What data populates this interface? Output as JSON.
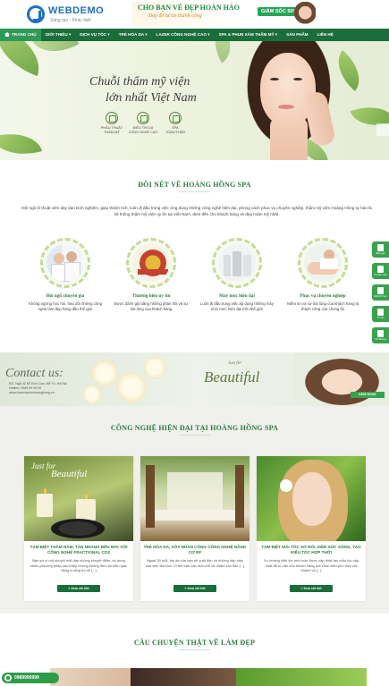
{
  "header": {
    "logo_text": "WEBDEMO",
    "logo_slogan": "Sáng tạo - Khác biệt",
    "ad_title": "CHO BẠN VẺ ĐẸP HOÀN HẢO",
    "ad_subtitle": "Đẹp để tự tin thành công",
    "ad_badge": "GIẢM SỐC 50%+"
  },
  "nav": {
    "items": [
      {
        "label": "TRANG CHỦ"
      },
      {
        "label": "GIỚI THIỆU ▾"
      },
      {
        "label": "DỊCH VỤ TÓC ▾"
      },
      {
        "label": "TRẺ HÓA DA ▾"
      },
      {
        "label": "LAZER CÔNG NGHỆ CAO ▾"
      },
      {
        "label": "SPA & PHUN XĂM THẨM MỸ ▾"
      },
      {
        "label": "SẢN PHẨM"
      },
      {
        "label": "LIÊN HỆ"
      }
    ]
  },
  "hero": {
    "title_line1": "Chuỗi thẩm mỹ viện",
    "title_line2": "lớn nhất Việt Nam",
    "features": [
      {
        "l1": "PHẪU THUẬT",
        "l2": "THẨM MỸ"
      },
      {
        "l1": "ĐIỀU TRỊ DA",
        "l2": "CÔNG NGHỆ CAO"
      },
      {
        "l1": "SPA",
        "l2": "TOÀN THÂN"
      }
    ]
  },
  "about": {
    "title": "ĐÔI NÉT VỀ HOÀNG HỒNG SPA",
    "text": "Đội ngũ kĩ thuật viên dày dạn kinh nghiệm, giàu thành tích, luôn đi đầu trong việc ứng dụng những công nghệ hiện đại, phong cách phục vụ chuyên nghiệp, thẩm mỹ viện Hoàng Hồng tự hào là hệ thống thẩm mỹ viện uy tín tại Việt Nam, đem đến cho khách hàng vẻ đẹp hoàn mỹ nhất.",
    "columns": [
      {
        "name": "Đội ngũ chuyên gia",
        "desc": "Không ngừng học hỏi, trau dồi những công nghệ làm đẹp hàng đầu thế giới"
      },
      {
        "name": "Thương hiệu uy tín",
        "desc": "Được đánh giá bằng những phản hồi và sự hài lòng của khách hàng"
      },
      {
        "name": "Máy móc hiện đại",
        "desc": "Luôn đi đầu trong việc áp dụng những máy móc mới, hiện đại trên thế giới"
      },
      {
        "name": "Phục vụ chuyên nghiệp",
        "desc": "Niềm tin và sự hài lòng của khách hàng là thành công của chúng tôi"
      }
    ]
  },
  "side_widgets": [
    {
      "label": "Bảng giá"
    },
    {
      "label": "Khuyến mãi"
    },
    {
      "label": "Đặt lịch hẹn"
    },
    {
      "label": "Tư vấn"
    },
    {
      "label": "Chỉ đường"
    }
  ],
  "contact": {
    "title": "Contact us:",
    "addr1": "ĐC: Ngõ 42 Đỗ Đức Dục, Mễ Trì, Hà Nội",
    "addr2": "Hotline: 0989.99.99.99",
    "addr3": "www.thammyvienhoanghong.vn",
    "just_for": "Just for",
    "beautiful": "Beautiful",
    "cta": "XEM NGAY"
  },
  "tech": {
    "title": "CÔNG NGHỆ HIỆN ĐẠI TẠI HOÀNG HỒNG SPA",
    "cards": [
      {
        "title": "TẠM BIỆT THÂM NÁM, TÀN NHANG ĐẾN 99% VỚI CÔNG NGHỆ FRACTIONAL CO2",
        "desc": "Bạn sợ vì nốt khuyết mãi dày những khuyết điểm, số dụng nhiều phương pháp can thiệp nhưng không đem lại hiệu quả, đang lo lắng thì sẽ [...]",
        "btn": "» Xem chi tiết"
      },
      {
        "title": "TRẺ HÓA DA, XÓA NHĂN CÔNG CÔNG NGHỆ NÂNG CƠ RF",
        "desc": "Ngoài 30 tuổi, làn da của bạn sẽ xuất đầu có những dấu hiệu của việc lão hoá. Vì thế bạn cần một chế độ chăm sóc đặc [...]",
        "btn": "» Xem chi tiết"
      },
      {
        "title": "TẠM BIỆT MÁI TÓC XƠ RỐI, KÉM SỨC SỐNG, TẠO KIỂU TÓC HỢP THỜI",
        "desc": "Xu hướng kiểu tóc mới luôn được cập nhật tạo mẫu tóc cập nhật để tư vấn cho khách hàng lựa chọn kiểu phù hợp với khách và [...]",
        "btn": "» Xem chi tiết"
      }
    ]
  },
  "stories": {
    "title": "CÂU CHUYỆN THẬT VỀ LÀM ĐẸP"
  },
  "hotline": {
    "number": "0989999999"
  }
}
